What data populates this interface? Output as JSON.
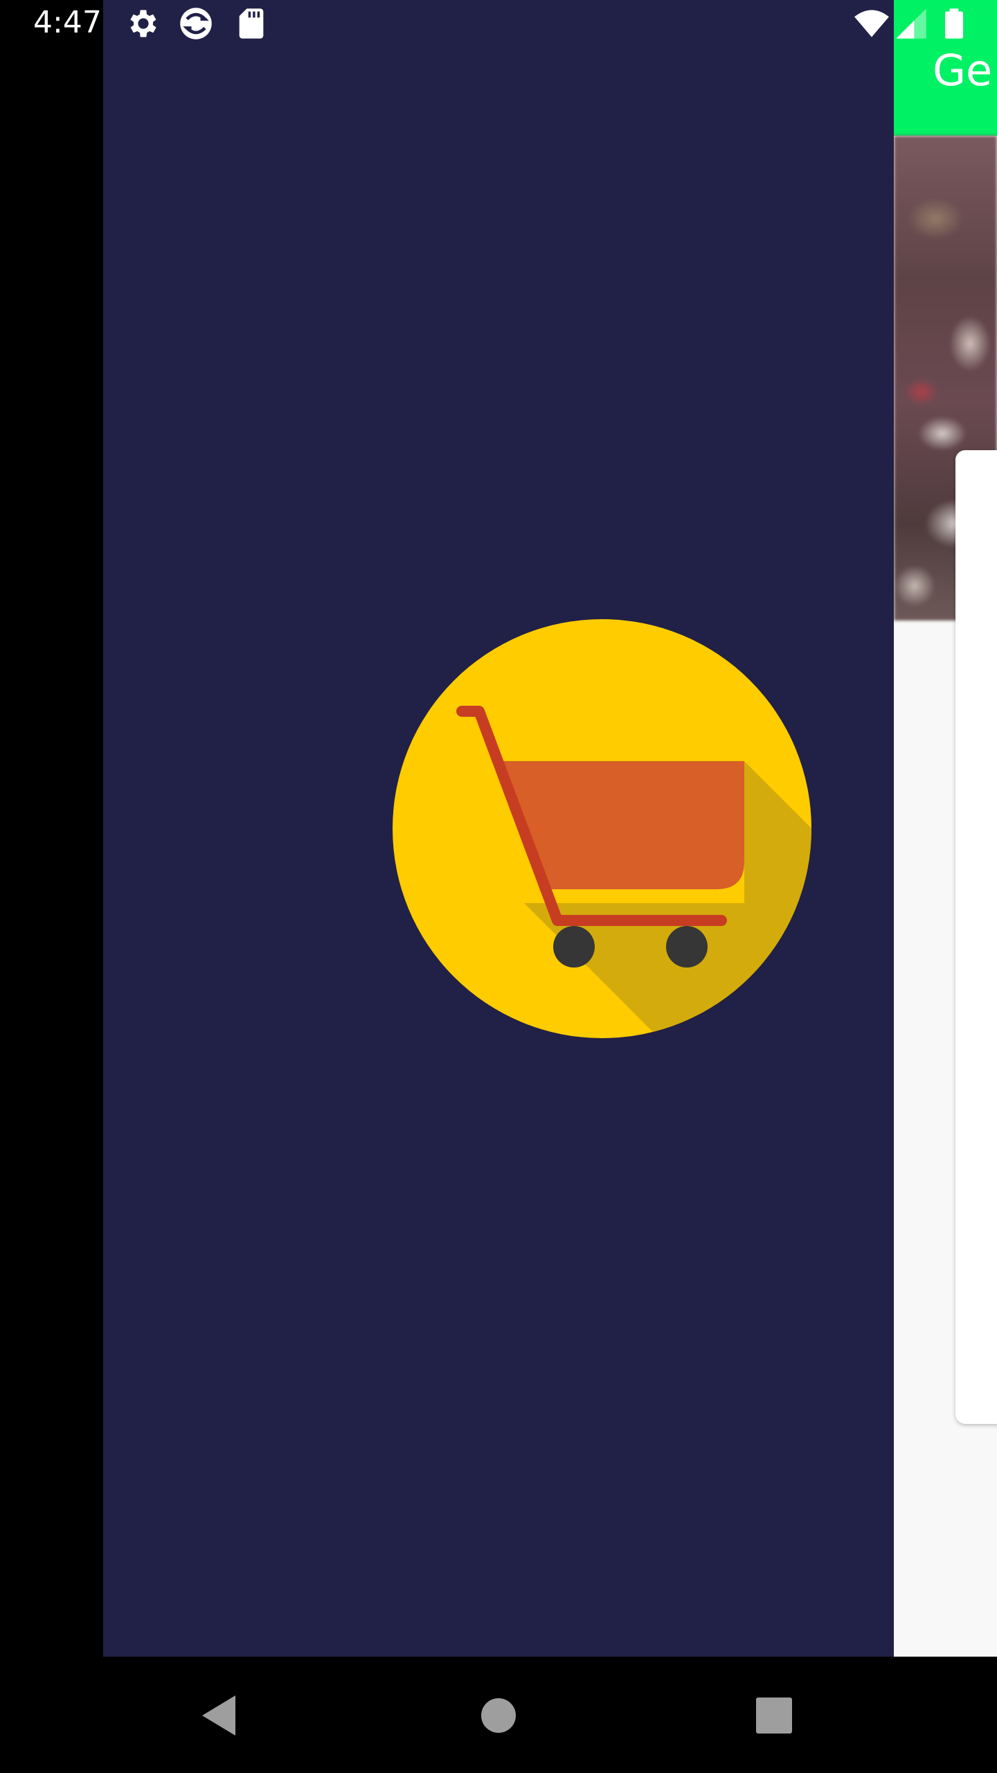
{
  "status_bar": {
    "time": "4:47",
    "left_icons": [
      "settings-icon",
      "sync-app-icon",
      "sd-card-icon"
    ],
    "right_icons": [
      "wifi-icon",
      "cell-signal-icon",
      "battery-icon"
    ]
  },
  "drawer": {
    "background": "#212046",
    "logo": "shopping-cart-icon",
    "logo_colors": {
      "circle": "#ffcc00",
      "shadow": "#d4ab0c",
      "basket": "#d85f28",
      "frame": "#c73d22",
      "wheels": "#363636"
    }
  },
  "app": {
    "toolbar_title": "Ge",
    "toolbar_color": "#00f264"
  },
  "nav_bar": {
    "buttons": [
      "back-button",
      "home-button",
      "recents-button"
    ]
  }
}
